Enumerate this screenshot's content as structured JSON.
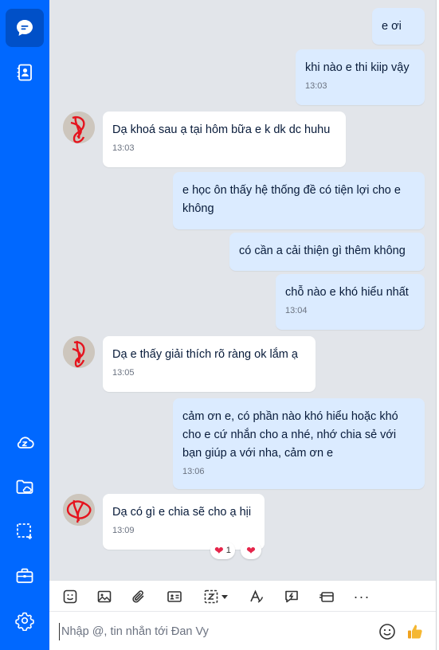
{
  "sidebar": {
    "items": [
      {
        "icon": "chat-bubble-icon",
        "active": true
      },
      {
        "icon": "contacts-icon",
        "active": false
      },
      {
        "icon": "cloud-icon",
        "active": false
      },
      {
        "icon": "folder-icon",
        "active": false
      },
      {
        "icon": "screenshot-icon",
        "active": false
      },
      {
        "icon": "briefcase-icon",
        "active": false
      },
      {
        "icon": "settings-icon",
        "active": false
      }
    ]
  },
  "messages": [
    {
      "from": "me",
      "text": "e ơi",
      "time": ""
    },
    {
      "from": "me",
      "text": "khi nào e thi kiip vậy",
      "time": "13:03"
    },
    {
      "from": "them",
      "text": "Dạ khoá sau ạ tại hôm bữa e k dk dc huhu",
      "time": "13:03"
    },
    {
      "from": "me",
      "text": "e học ôn thấy hệ thống đề có tiện lợi cho e không",
      "time": ""
    },
    {
      "from": "me",
      "text": "có cần a cải thiện gì thêm không",
      "time": ""
    },
    {
      "from": "me",
      "text": "chỗ nào e khó hiểu nhất",
      "time": "13:04"
    },
    {
      "from": "them",
      "text": "Dạ e thấy giải thích rõ ràng ok lắm ạ",
      "time": "13:05"
    },
    {
      "from": "me",
      "text": "cảm ơn e, có phần nào khó hiểu hoặc khó cho e cứ nhắn cho a nhé, nhớ chia sẻ với bạn giúp a với nha, cảm ơn e",
      "time": "13:06"
    },
    {
      "from": "them",
      "text": "Dạ có gì e chia sẽ cho ạ hịi",
      "time": "13:09"
    }
  ],
  "reactions": {
    "heart_glyph": "❤",
    "count": "1"
  },
  "toolbar": {
    "more_label": "···"
  },
  "composer": {
    "placeholder": "Nhập @, tin nhắn tới Đan Vy"
  },
  "colors": {
    "rail": "#0068ff",
    "my_bubble": "#dbebff",
    "their_bubble": "#ffffff",
    "heart": "#e5254a"
  }
}
